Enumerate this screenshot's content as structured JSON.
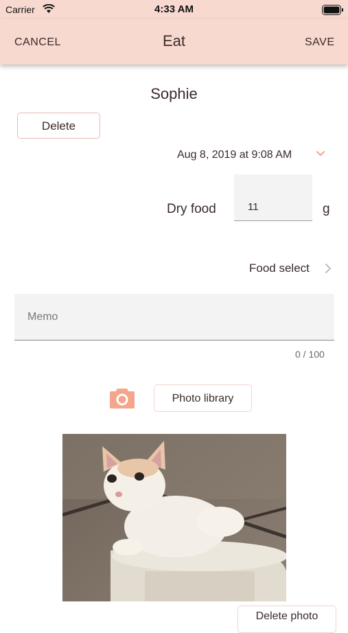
{
  "status_bar": {
    "carrier": "Carrier",
    "time": "4:33 AM"
  },
  "nav": {
    "cancel_label": "CANCEL",
    "title": "Eat",
    "save_label": "SAVE"
  },
  "pet": {
    "name": "Sophie"
  },
  "actions": {
    "delete_label": "Delete"
  },
  "datetime": {
    "value": "Aug 8, 2019 at 9:08 AM"
  },
  "food": {
    "label": "Dry food",
    "amount": "11",
    "unit": "g",
    "select_label": "Food select"
  },
  "memo": {
    "placeholder": "Memo",
    "counter": "0 / 100"
  },
  "photo": {
    "library_label": "Photo library",
    "delete_label": "Delete photo"
  },
  "colors": {
    "header_bg": "#f8d9d0",
    "accent": "#f4a58c",
    "text": "#3a2a2a"
  }
}
